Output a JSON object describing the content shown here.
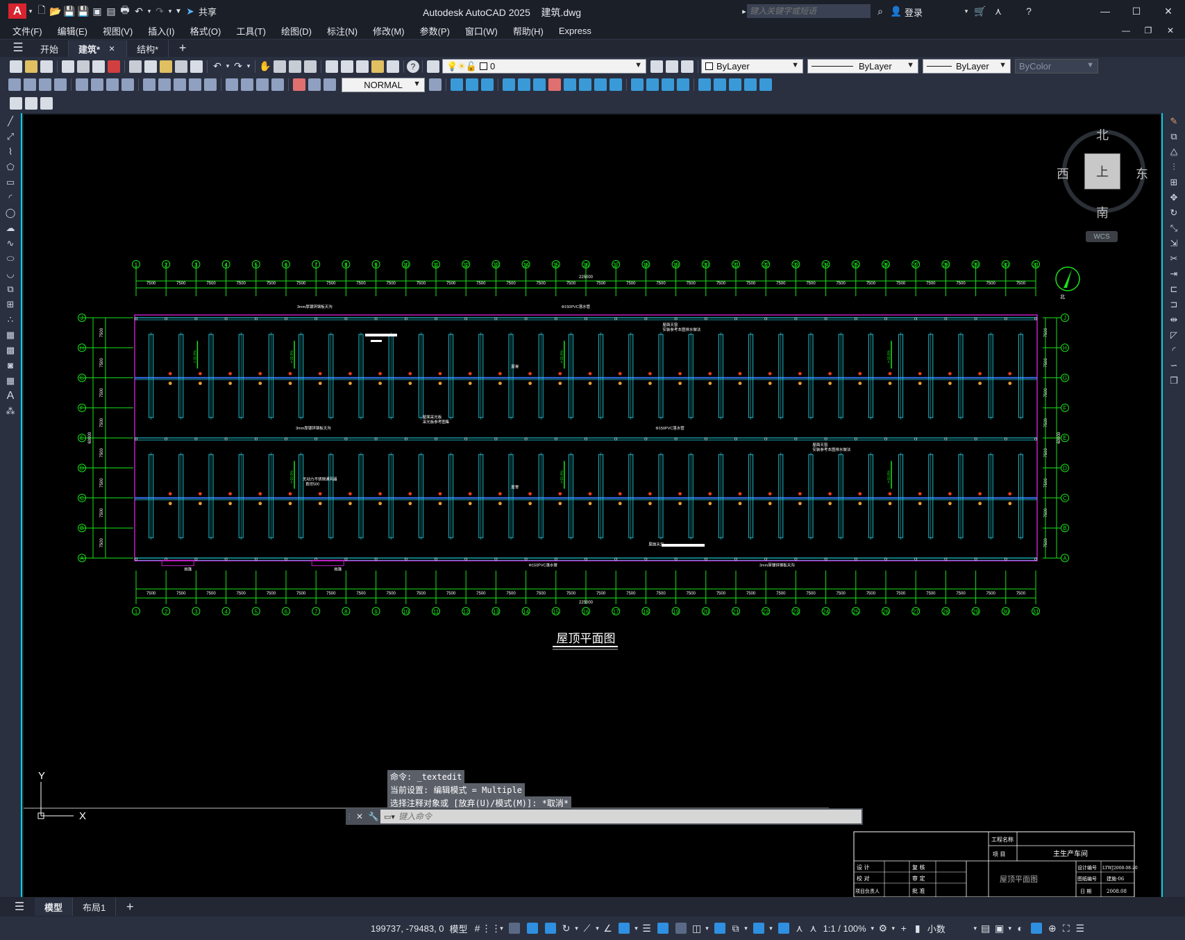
{
  "title": {
    "app": "Autodesk AutoCAD 2025",
    "file": "建筑.dwg",
    "share": "共享",
    "search_placeholder": "键入关键字或短语",
    "login": "登录",
    "logo": "A"
  },
  "menu": [
    "文件(F)",
    "编辑(E)",
    "视图(V)",
    "插入(I)",
    "格式(O)",
    "工具(T)",
    "绘图(D)",
    "标注(N)",
    "修改(M)",
    "参数(P)",
    "窗口(W)",
    "帮助(H)",
    "Express"
  ],
  "doc_tabs": [
    {
      "label": "开始"
    },
    {
      "label": "建筑*",
      "active": true
    },
    {
      "label": "结构*"
    }
  ],
  "toolbar": {
    "layer": "0",
    "color": "ByLayer",
    "linetype": "ByLayer",
    "lineweight": "ByLayer",
    "plotstyle": "ByColor",
    "dimstyle": "NORMAL"
  },
  "viewcube": {
    "north": "北",
    "south": "南",
    "west": "西",
    "east": "东",
    "top": "上",
    "wcs": "WCS"
  },
  "drawing": {
    "title": "屋顶平面图",
    "col_labels": [
      "1",
      "2",
      "3",
      "4",
      "5",
      "6",
      "7",
      "8",
      "9",
      "10",
      "11",
      "12",
      "13",
      "14",
      "15",
      "16",
      "17",
      "18",
      "19",
      "20",
      "21",
      "22",
      "23",
      "24",
      "25",
      "26",
      "27",
      "28",
      "29",
      "30",
      "31"
    ],
    "row_labels": [
      "J",
      "H",
      "G",
      "F",
      "E",
      "D",
      "C",
      "B",
      "A"
    ],
    "span_dim": "7500",
    "total_dim": "225000",
    "row_dim": "7500",
    "total_height": "60000",
    "notes": [
      "3mm厚镀锌钢板天沟",
      "Φ150PVC落水管",
      "屋面采光板",
      "采光板参考图集",
      "屋面天窗",
      "安装参考本图排水做法",
      "雨篷",
      "屋面天沟",
      "无动力不锈钢通风器",
      "直径500",
      "屋脊",
      "i=10.0%"
    ],
    "north_label": "北"
  },
  "command": {
    "lines": [
      "命令: _textedit",
      "当前设置: 编辑模式 = Multiple",
      "选择注释对象或 [放弃(U)/模式(M)]: *取消*"
    ],
    "placeholder": "键入命令"
  },
  "titleblock": {
    "project_label": "工程名称",
    "item_label": "项 目",
    "item_value": "主生产车间",
    "drawing_name": "屋顶平面图",
    "design": "设 计",
    "check": "校 对",
    "review": "复 核",
    "audit": "审 定",
    "leader": "项目负责人",
    "approve": "批 准",
    "design_no_label": "设计编号",
    "design_no": "LTWJ2008-08-20",
    "drawing_no_label": "图纸编号",
    "drawing_no": "建施-06",
    "date_label": "日 期",
    "date": "2008.08"
  },
  "ucs": {
    "x": "X",
    "y": "Y"
  },
  "layouts": [
    {
      "label": "模型",
      "active": true
    },
    {
      "label": "布局1"
    }
  ],
  "status": {
    "coords": "199737, -79483, 0",
    "mode": "模型",
    "scale": "1:1 / 100%",
    "units": "小数"
  }
}
